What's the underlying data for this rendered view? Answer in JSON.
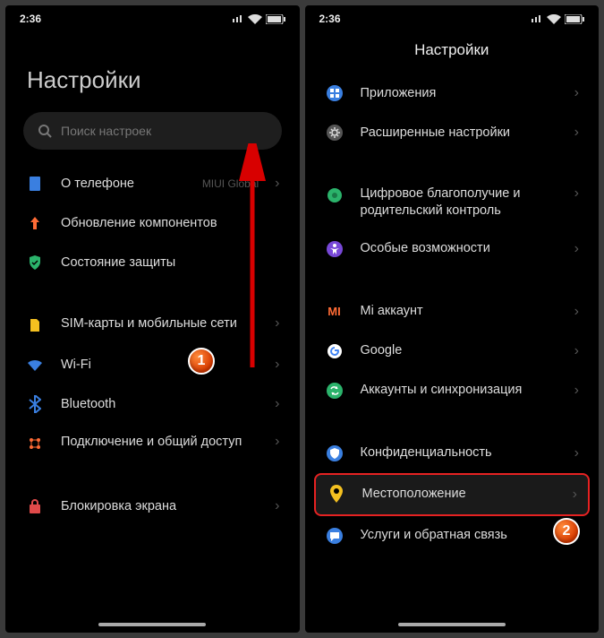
{
  "status": {
    "time": "2:36"
  },
  "left": {
    "title": "Настройки",
    "search_placeholder": "Поиск настроек",
    "rows": [
      {
        "icon": "phone",
        "label": "О телефоне",
        "sub": "MIUI Global"
      },
      {
        "icon": "update",
        "label": "Обновление компонентов"
      },
      {
        "icon": "shield",
        "label": "Состояние защиты"
      }
    ],
    "rows2": [
      {
        "icon": "sim",
        "label": "SIM-карты и мобильные сети"
      },
      {
        "icon": "wifi",
        "label": "Wi-Fi"
      },
      {
        "icon": "bt",
        "label": "Bluetooth"
      },
      {
        "icon": "share",
        "label": "Подключение и общий доступ"
      }
    ],
    "rows3": [
      {
        "icon": "lock",
        "label": "Блокировка экрана"
      }
    ]
  },
  "right": {
    "title": "Настройки",
    "rows": [
      {
        "icon": "apps",
        "label": "Приложения"
      },
      {
        "icon": "settings",
        "label": "Расширенные настройки"
      }
    ],
    "rows2": [
      {
        "icon": "wellbeing",
        "label": "Цифровое благополучие и родительский контроль"
      },
      {
        "icon": "a11y",
        "label": "Особые возможности"
      }
    ],
    "rows3": [
      {
        "icon": "mi",
        "label": "Mi аккаунт"
      },
      {
        "icon": "google",
        "label": "Google"
      },
      {
        "icon": "sync",
        "label": "Аккаунты и синхронизация"
      }
    ],
    "rows4": [
      {
        "icon": "privacy",
        "label": "Конфиденциальность"
      },
      {
        "icon": "location",
        "label": "Местоположение",
        "highlight": true
      },
      {
        "icon": "feedback",
        "label": "Услуги и обратная связь"
      }
    ]
  },
  "badges": {
    "one": "1",
    "two": "2"
  }
}
